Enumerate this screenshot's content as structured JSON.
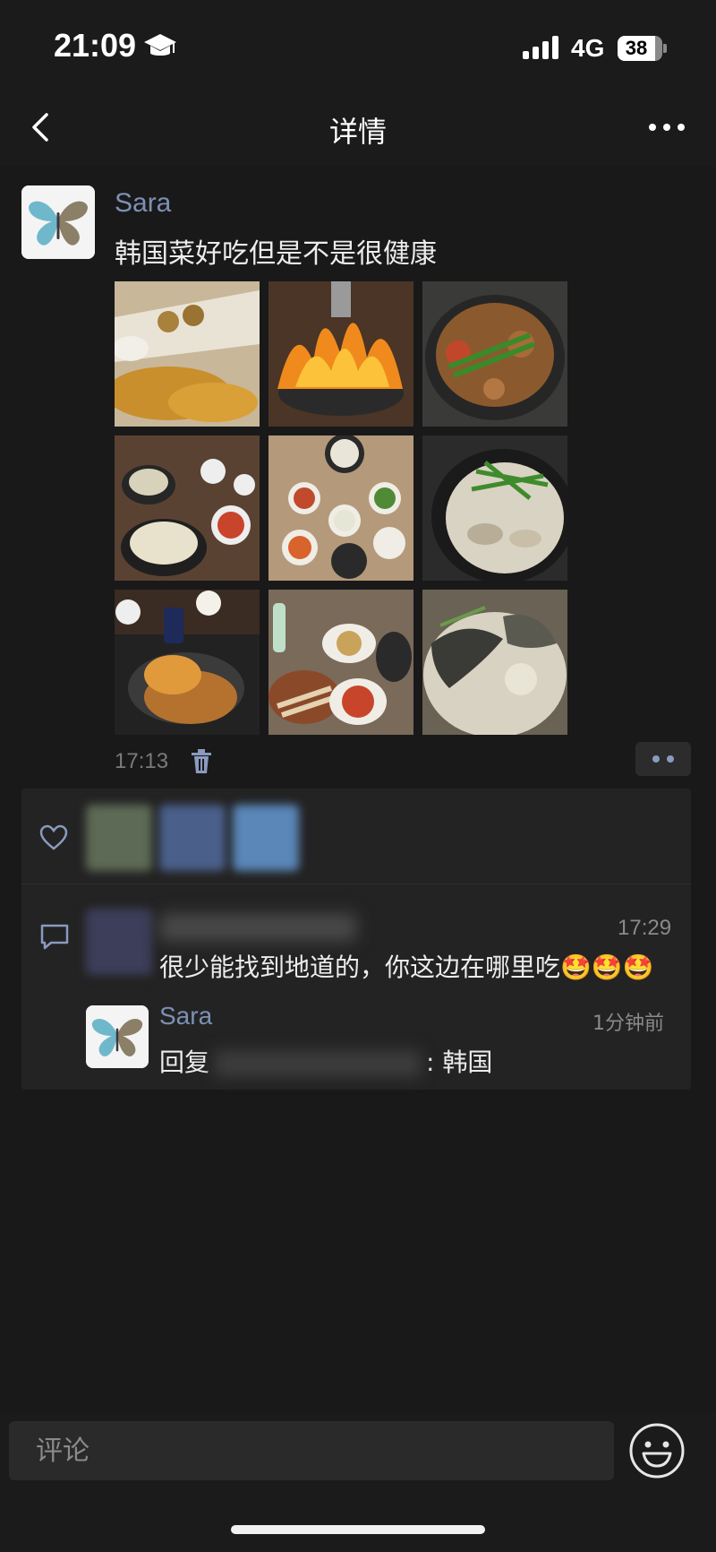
{
  "status_bar": {
    "time": "21:09",
    "network": "4G",
    "battery": "38"
  },
  "nav": {
    "title": "详情"
  },
  "post": {
    "author": "Sara",
    "text": "韩国菜好吃但是不是很健康",
    "time": "17:13",
    "photos": [
      "fried-chicken",
      "flaming-grill",
      "stew-pot",
      "soup-set-meal",
      "side-dishes",
      "beef-bone-soup",
      "pork-cutlet-curry",
      "skewers-table",
      "fish-soup"
    ]
  },
  "comment": {
    "time": "17:29",
    "text": "很少能找到地道的，你这边在哪里吃🤩🤩🤩"
  },
  "reply": {
    "author": "Sara",
    "time": "1分钟前",
    "prefix": "回复",
    "suffix": ": 韩国"
  },
  "input": {
    "placeholder": "评论"
  },
  "colors": {
    "background": "#191919",
    "link_name": "#7d90b4",
    "panel": "#232323"
  }
}
